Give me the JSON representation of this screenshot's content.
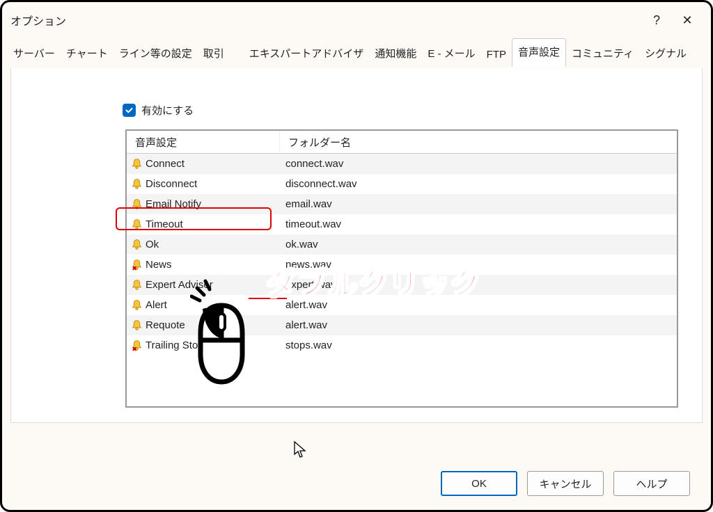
{
  "titlebar": {
    "title": "オプション"
  },
  "tabs": [
    "サーバー",
    "チャート",
    "ライン等の設定",
    "取引",
    "エキスパートアドバイザ",
    "通知機能",
    "E - メール",
    "FTP",
    "音声設定",
    "コミュニティ",
    "シグナル"
  ],
  "activeTab": "音声設定",
  "enable": {
    "label": "有効にする",
    "checked": true
  },
  "table": {
    "headers": [
      "音声設定",
      "フォルダー名"
    ],
    "rows": [
      {
        "icon": "bell",
        "name": "Connect",
        "file": "connect.wav",
        "striped": true
      },
      {
        "icon": "bell",
        "name": "Disconnect",
        "file": "disconnect.wav",
        "striped": false
      },
      {
        "icon": "bell",
        "name": "Email Notify",
        "file": "email.wav",
        "striped": true
      },
      {
        "icon": "bell",
        "name": "Timeout",
        "file": "timeout.wav",
        "striped": false
      },
      {
        "icon": "bell",
        "name": "Ok",
        "file": "ok.wav",
        "striped": true
      },
      {
        "icon": "bell-off",
        "name": "News",
        "file": "news.wav",
        "striped": false,
        "highlight": true
      },
      {
        "icon": "bell",
        "name": "Expert Advisor",
        "file": "expert.wav",
        "striped": true
      },
      {
        "icon": "bell",
        "name": "Alert",
        "file": "alert.wav",
        "striped": false
      },
      {
        "icon": "bell",
        "name": "Requote",
        "file": "alert.wav",
        "striped": true
      },
      {
        "icon": "bell-off",
        "name": "Trailing Stop",
        "file": "stops.wav",
        "striped": false
      }
    ]
  },
  "buttons": {
    "ok": "OK",
    "cancel": "キャンセル",
    "help": "ヘルプ"
  },
  "annotation": {
    "text": "ダブルクリック"
  }
}
